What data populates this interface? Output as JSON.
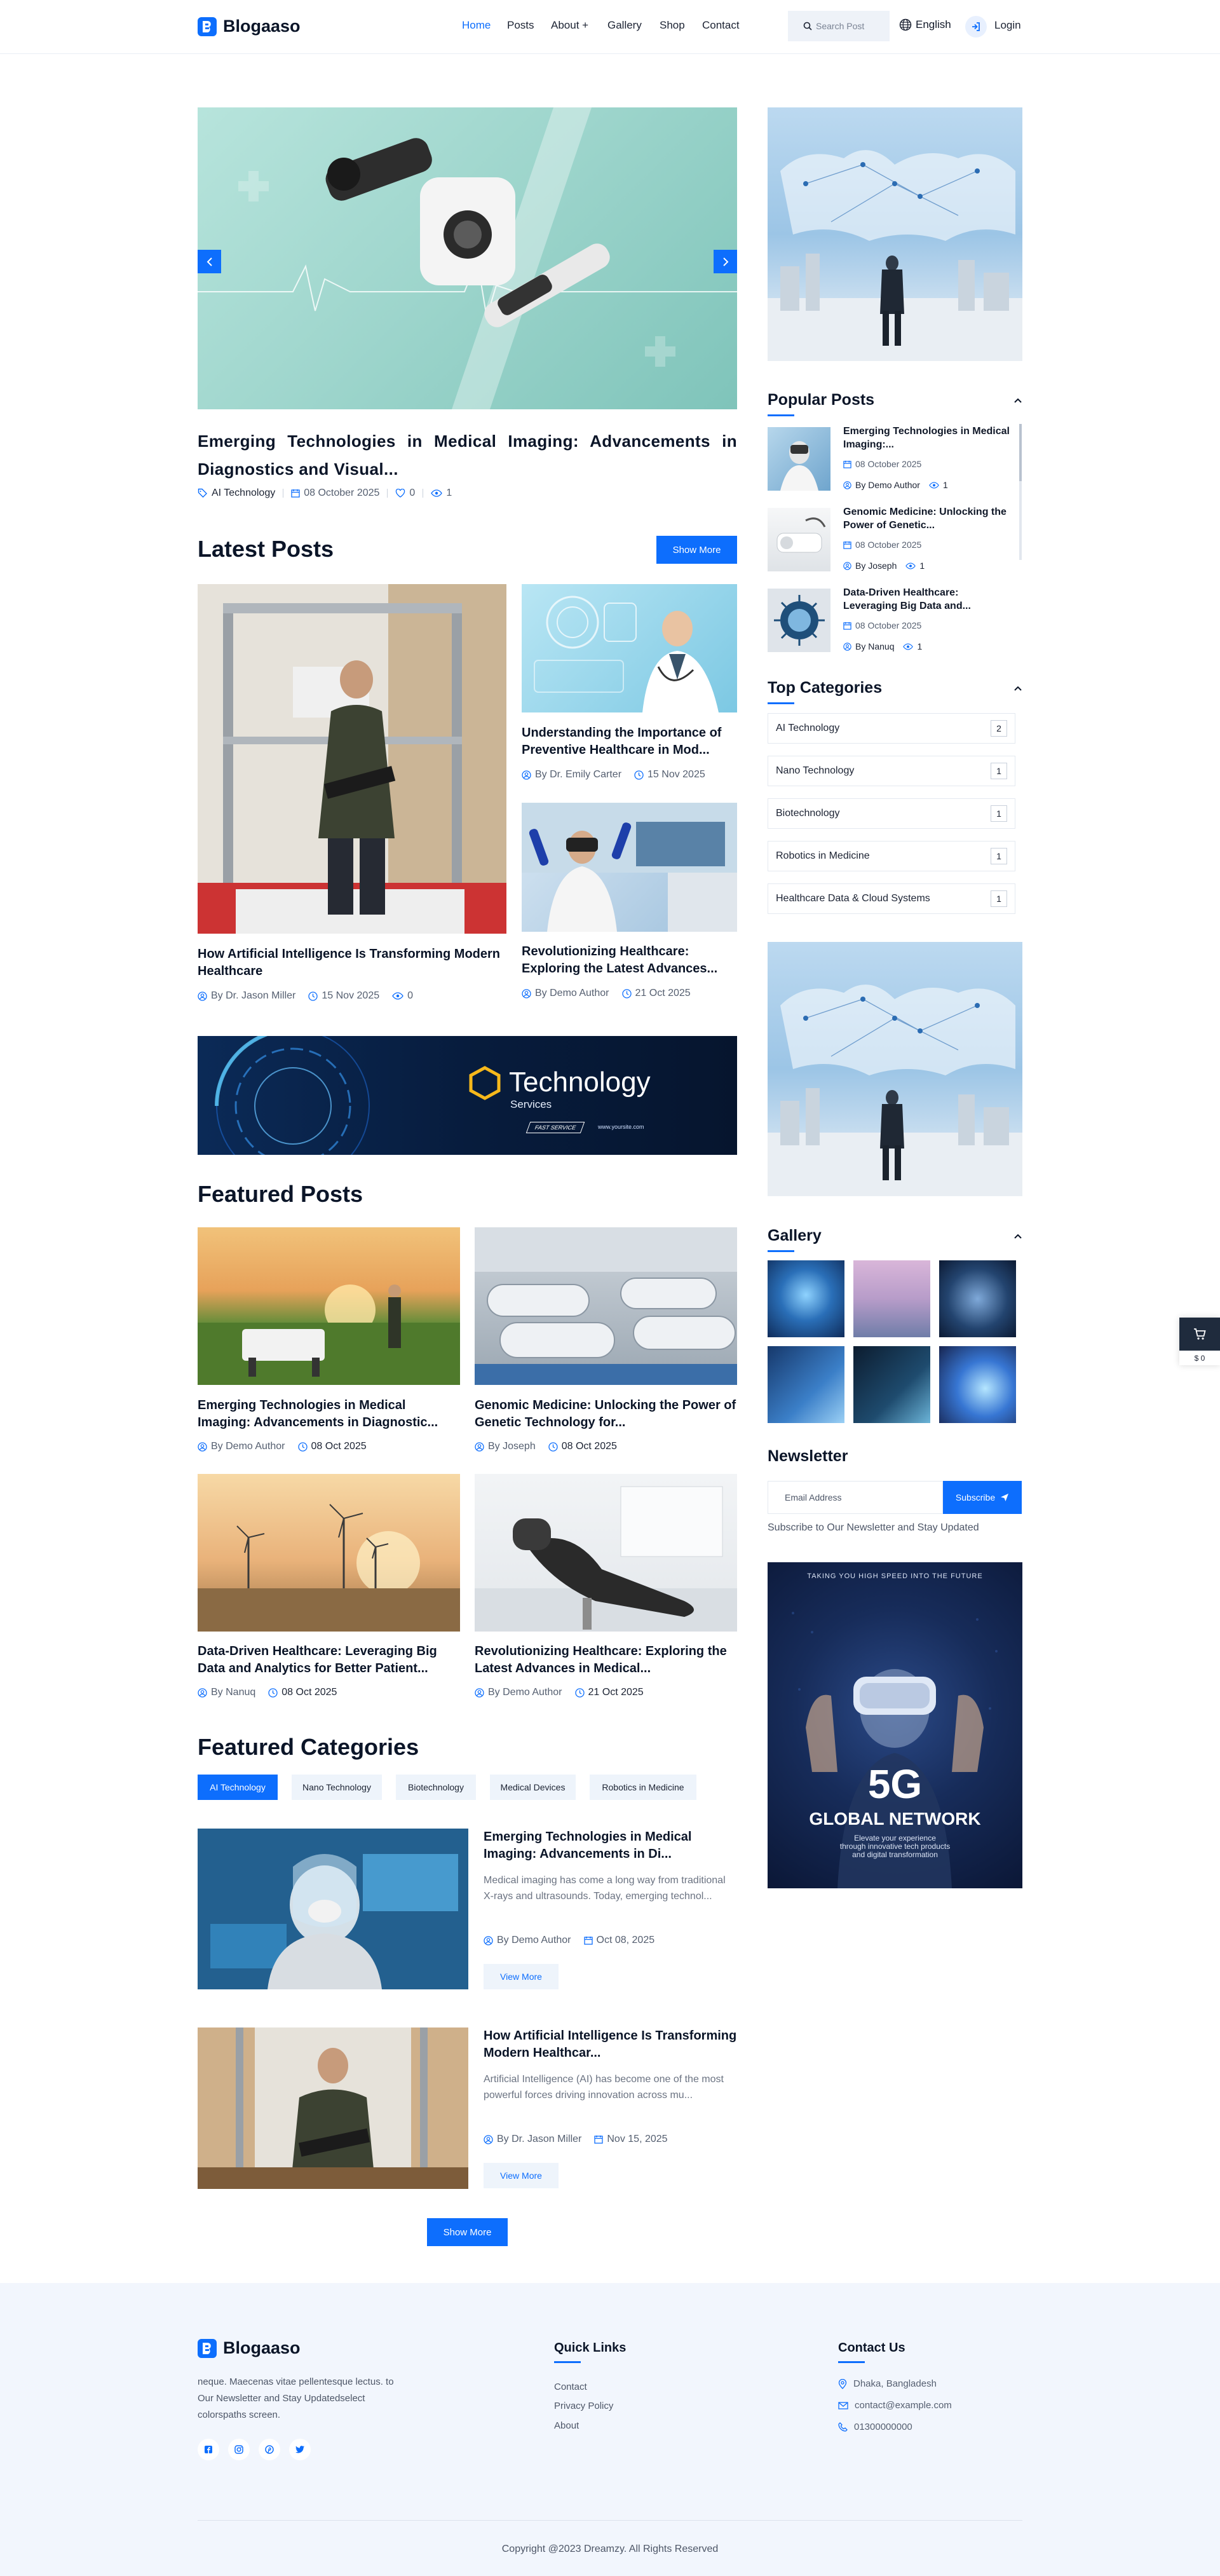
{
  "header": {
    "logo": "Blogaaso",
    "nav": [
      "Home",
      "Posts",
      "About +",
      "Gallery",
      "Shop",
      "Contact"
    ],
    "search_placeholder": "Search Post",
    "language": "English",
    "login": "Login"
  },
  "hero": {
    "title": "Emerging Technologies in Medical Imaging: Advancements in Diagnostics and Visual...",
    "category": "AI Technology",
    "date": "08 October 2025",
    "likes": "0",
    "views": "1"
  },
  "latest": {
    "title": "Latest Posts",
    "show_more": "Show More",
    "posts": [
      {
        "title": "How Artificial Intelligence Is Transforming Modern Healthcare",
        "author": "By Dr. Jason Miller",
        "date": "15 Nov 2025",
        "views": "0"
      },
      {
        "title": "Understanding the Importance of Preventive Healthcare in Mod...",
        "author": "By Dr. Emily Carter",
        "date": "15 Nov 2025"
      },
      {
        "title": "Revolutionizing Healthcare: Exploring the Latest Advances...",
        "author": "By Demo Author",
        "date": "21 Oct 2025"
      }
    ]
  },
  "banner": {
    "title": "Technology",
    "subtitle": "Services",
    "badge": "FAST SERVICE",
    "url": "www.yoursite.com"
  },
  "featured_posts": {
    "title": "Featured Posts",
    "posts": [
      {
        "title": "Emerging Technologies in Medical Imaging: Advancements in Diagnostic...",
        "author": "By Demo Author",
        "date": "08 Oct 2025"
      },
      {
        "title": "Genomic Medicine: Unlocking the Power of Genetic Technology for...",
        "author": "By Joseph",
        "date": "08 Oct 2025"
      },
      {
        "title": "Data-Driven Healthcare: Leveraging Big Data and Analytics for Better Patient...",
        "author": "By Nanuq",
        "date": "08 Oct 2025"
      },
      {
        "title": "Revolutionizing Healthcare: Exploring the Latest Advances in Medical...",
        "author": "By Demo Author",
        "date": "21 Oct 2025"
      }
    ]
  },
  "featured_categories": {
    "title": "Featured Categories",
    "chips": [
      "AI Technology",
      "Nano Technology",
      "Biotechnology",
      "Medical Devices",
      "Robotics in Medicine"
    ],
    "posts": [
      {
        "title": "Emerging Technologies in Medical Imaging: Advancements in Di...",
        "excerpt": "Medical imaging has come a long way from traditional X-rays and ultrasounds. Today, emerging technol...",
        "author": "By Demo Author",
        "date": "Oct 08, 2025",
        "button": "View More"
      },
      {
        "title": "How Artificial Intelligence Is Transforming Modern Healthcar...",
        "excerpt": "Artificial Intelligence (AI) has become one of the most powerful forces driving innovation across mu...",
        "author": "By Dr. Jason Miller",
        "date": "Nov 15, 2025",
        "button": "View More"
      }
    ],
    "show_more": "Show More"
  },
  "sidebar": {
    "popular_title": "Popular Posts",
    "popular": [
      {
        "title": "Emerging Technologies in Medical Imaging:...",
        "date": "08 October 2025",
        "author": "By Demo Author",
        "views": "1"
      },
      {
        "title": "Genomic Medicine: Unlocking the Power of Genetic...",
        "date": "08 October 2025",
        "author": "By Joseph",
        "views": "1"
      },
      {
        "title": "Data-Driven Healthcare: Leveraging Big Data and...",
        "date": "08 October 2025",
        "author": "By Nanuq",
        "views": "1"
      }
    ],
    "categories_title": "Top Categories",
    "categories": [
      {
        "name": "AI Technology",
        "count": "2"
      },
      {
        "name": "Nano Technology",
        "count": "1"
      },
      {
        "name": "Biotechnology",
        "count": "1"
      },
      {
        "name": "Robotics in Medicine",
        "count": "1"
      },
      {
        "name": "Healthcare Data & Cloud Systems",
        "count": "1"
      }
    ],
    "gallery_title": "Gallery",
    "newsletter_title": "Newsletter",
    "newsletter_placeholder": "Email Address",
    "subscribe": "Subscribe",
    "newsletter_note": "Subscribe to Our Newsletter and Stay Updated",
    "ad": {
      "top": "TAKING YOU HIGH SPEED INTO THE FUTURE",
      "big": "5G",
      "sub": "GLOBAL NETWORK",
      "desc1": "Elevate your experience",
      "desc2": "through innovative tech products",
      "desc3": "and digital transformation"
    }
  },
  "floating_cart": {
    "price": "$ 0"
  },
  "footer": {
    "logo": "Blogaaso",
    "about": "neque. Maecenas vitae pellentesque lectus. to Our Newsletter and Stay Updatedselect colorspaths screen.",
    "quick_links_title": "Quick Links",
    "quick_links": [
      "Contact",
      "Privacy Policy",
      "About"
    ],
    "contact_title": "Contact Us",
    "address": "Dhaka, Bangladesh",
    "email": "contact@example.com",
    "phone": "01300000000",
    "copyright": "Copyright @2023 Dreamzy. All Rights Reserved"
  },
  "colors": {
    "accent": "#0d6efd",
    "footer_bg": "#f2f6fd",
    "dark": "#0b1528"
  }
}
